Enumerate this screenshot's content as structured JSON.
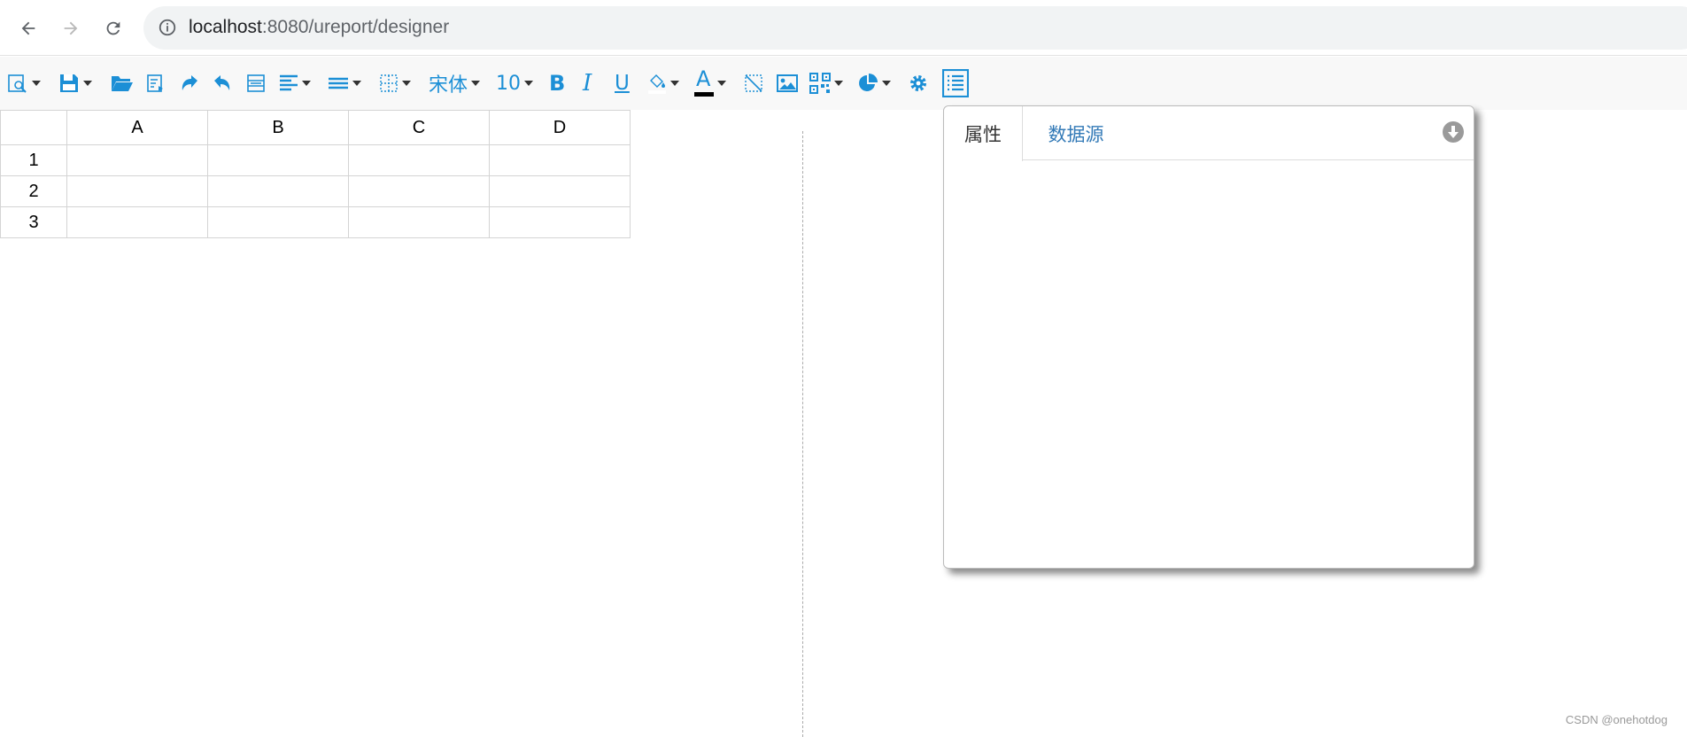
{
  "browser": {
    "url_host": "localhost",
    "url_rest": ":8080/ureport/designer"
  },
  "toolbar": {
    "font_name": "宋体",
    "font_size": "10",
    "accent_color": "#1c8fd6",
    "icons": [
      "preview-icon",
      "save-icon",
      "open-folder-icon",
      "import-icon",
      "redo-icon",
      "undo-icon",
      "merge-cells-icon",
      "align-icon",
      "valign-icon",
      "border-icon",
      "font-dropdown",
      "font-size-dropdown",
      "bold-icon",
      "italic-icon",
      "underline-icon",
      "fill-color-icon",
      "font-color-icon",
      "slash-icon",
      "image-icon",
      "qrcode-icon",
      "chart-icon",
      "settings-icon",
      "property-panel-icon"
    ],
    "bold_label": "B",
    "italic_label": "I",
    "underline_label": "U",
    "font_color_label": "A"
  },
  "grid": {
    "columns": [
      "A",
      "B",
      "C",
      "D"
    ],
    "rows": [
      "1",
      "2",
      "3"
    ]
  },
  "panel": {
    "tab_properties": "属性",
    "tab_datasource": "数据源"
  },
  "watermark": "CSDN @onehotdog"
}
